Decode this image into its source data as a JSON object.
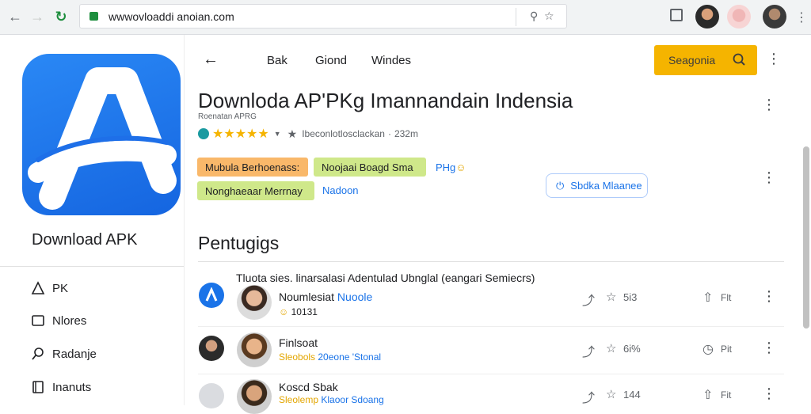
{
  "browser": {
    "url": "wwwovloaddi anoian.com"
  },
  "left_panel": {
    "title": "Download APK",
    "items": [
      {
        "label": "PK",
        "icon": "warning-icon"
      },
      {
        "label": "Nlores",
        "icon": "folder-icon"
      },
      {
        "label": "Radanje",
        "icon": "search-icon"
      },
      {
        "label": "Inanuts",
        "icon": "book-icon"
      }
    ]
  },
  "header": {
    "tabs": [
      "Bak",
      "Giond",
      "Windes"
    ],
    "search_label": "Seagonia"
  },
  "app": {
    "title": "Downloda AP'PKg Imannandain Indensia",
    "subtitle": "Roenatan APRG",
    "rating_text": "Ibeconlotlosclackan",
    "size": "232m",
    "tags": [
      {
        "label": "Mubula Berhoenass:",
        "style": "orange"
      },
      {
        "label": "Noojaai Boagd Sma",
        "style": "green"
      },
      {
        "label": "Nonghaeaar Merrnay",
        "style": "green"
      }
    ],
    "link_tag_1": "PHg",
    "link_tag_2": "Nadoon",
    "action_button": "Sbdka Mlaanee"
  },
  "section": {
    "title": "Pentugigs",
    "heading": "Tluota sies. linarsalasi Adentulad Ubnglal (eangari Semiecrs)"
  },
  "reviews": [
    {
      "name": "Noumlesiat",
      "name_tag": "Nuoole",
      "meta_1": "",
      "meta_2": "10131",
      "count": "5i3",
      "share_label": "Flt"
    },
    {
      "name": "Finlsoat",
      "name_tag": "",
      "meta_1": "Sleobols",
      "meta_2": "20eone 'Stonal",
      "count": "6i%",
      "share_label": "Pit"
    },
    {
      "name": "Koscd Sbak",
      "name_tag": "",
      "meta_1": "Sleolemp",
      "meta_2": "Klaoor",
      "meta_3": "Sdoang",
      "count": "144",
      "share_label": "Fit"
    }
  ],
  "colors": {
    "accent": "#f5b400",
    "link": "#1a73e8",
    "app_icon": "#1e73ee",
    "tag_orange": "#f9b86a",
    "tag_green": "#cfe88a"
  }
}
